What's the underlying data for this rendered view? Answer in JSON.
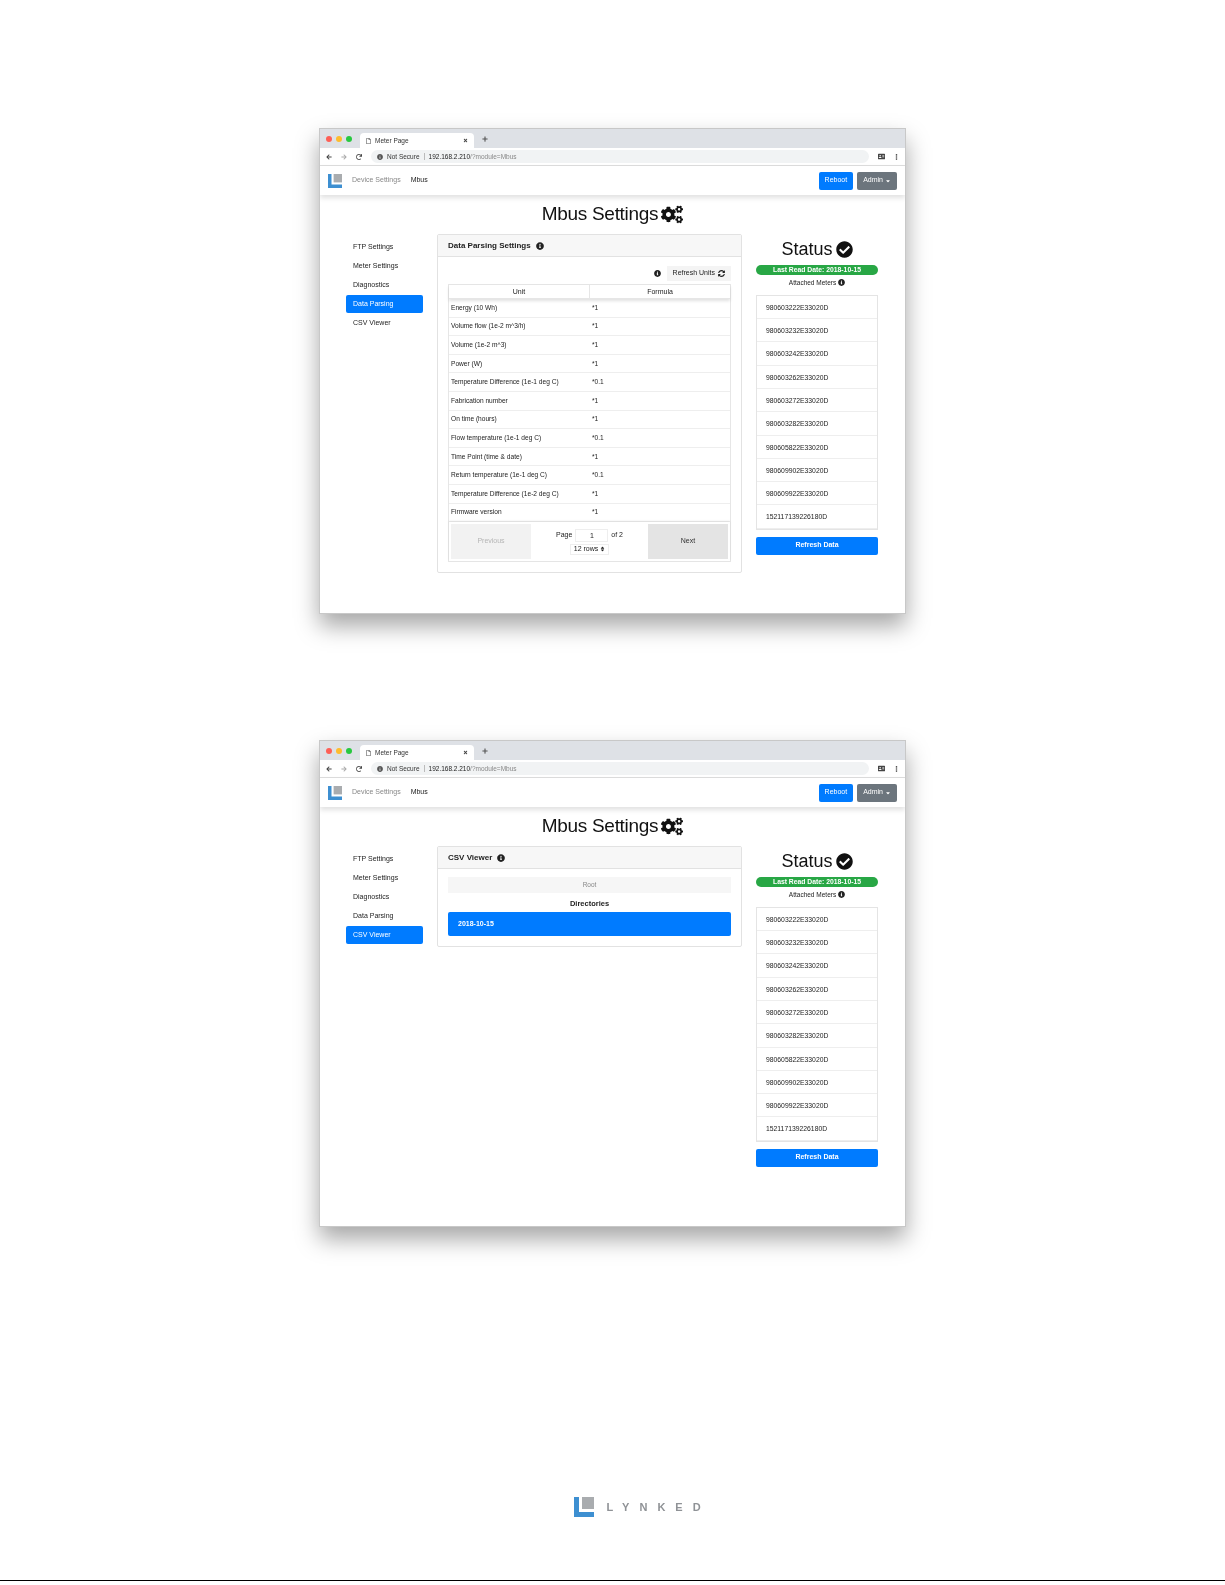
{
  "windows": [
    {
      "tab_title": "Meter Page",
      "security": "Not Secure",
      "url_host": "192.168.2.210",
      "url_path": "/?module=Mbus",
      "breadcrumbs": [
        "Device Settings",
        "Mbus"
      ],
      "reboot": "Reboot",
      "admin": "Admin",
      "page_title": "Mbus Settings",
      "sidebar": [
        {
          "label": "FTP Settings",
          "selected": false
        },
        {
          "label": "Meter Settings",
          "selected": false
        },
        {
          "label": "Diagnostics",
          "selected": false
        },
        {
          "label": "Data Parsing",
          "selected": true
        },
        {
          "label": "CSV Viewer",
          "selected": false
        }
      ],
      "card": {
        "kind": "table",
        "title": "Data Parsing Settings",
        "refresh_button": "Refresh Units",
        "columns": [
          "Unit",
          "Formula"
        ],
        "rows": [
          [
            "Energy (10 Wh)",
            "*1"
          ],
          [
            "Volume flow (1e-2 m^3/h)",
            "*1"
          ],
          [
            "Volume (1e-2 m^3)",
            "*1"
          ],
          [
            "Power (W)",
            "*1"
          ],
          [
            "Temperature Difference (1e-1 deg C)",
            "*0.1"
          ],
          [
            "Fabrication number",
            "*1"
          ],
          [
            "On time (hours)",
            "*1"
          ],
          [
            "Flow temperature (1e-1 deg C)",
            "*0.1"
          ],
          [
            "Time Point (time & date)",
            "*1"
          ],
          [
            "Return temperature (1e-1 deg C)",
            "*0.1"
          ],
          [
            "Temperature Difference (1e-2 deg C)",
            "*1"
          ],
          [
            "Firmware version",
            "*1"
          ]
        ],
        "pagination": {
          "previous": {
            "label": "Previous",
            "disabled": true
          },
          "next": {
            "label": "Next",
            "disabled": false
          },
          "page_label": "Page",
          "page_value": "1",
          "of": "of 2",
          "rows_select": "12 rows"
        }
      },
      "status": {
        "title": "Status",
        "last_read": "Last Read Date: 2018-10-15",
        "attached_label": "Attached Meters",
        "meters": [
          "980603222E33020D",
          "980603232E33020D",
          "980603242E33020D",
          "980603262E33020D",
          "980603272E33020D",
          "980603282E33020D",
          "980605822E33020D",
          "980609902E33020D",
          "980609922E33020D",
          "152117139226180D"
        ],
        "refresh_button": "Refresh Data"
      }
    },
    {
      "tab_title": "Meter Page",
      "security": "Not Secure",
      "url_host": "192.168.2.210",
      "url_path": "/?module=Mbus",
      "breadcrumbs": [
        "Device Settings",
        "Mbus"
      ],
      "reboot": "Reboot",
      "admin": "Admin",
      "page_title": "Mbus Settings",
      "sidebar": [
        {
          "label": "FTP Settings",
          "selected": false
        },
        {
          "label": "Meter Settings",
          "selected": false
        },
        {
          "label": "Diagnostics",
          "selected": false
        },
        {
          "label": "Data Parsing",
          "selected": false
        },
        {
          "label": "CSV Viewer",
          "selected": true
        }
      ],
      "card": {
        "kind": "csv",
        "title": "CSV Viewer",
        "root": "Root",
        "directories_heading": "Directories",
        "directories": [
          {
            "label": "2018-10-15",
            "selected": true
          }
        ]
      },
      "status": {
        "title": "Status",
        "last_read": "Last Read Date: 2018-10-15",
        "attached_label": "Attached Meters",
        "meters": [
          "980603222E33020D",
          "980603232E33020D",
          "980603242E33020D",
          "980603262E33020D",
          "980603272E33020D",
          "980603282E33020D",
          "980605822E33020D",
          "980609902E33020D",
          "980609922E33020D",
          "152117139226180D"
        ],
        "refresh_button": "Refresh Data"
      }
    }
  ],
  "footer": {
    "brand": "LYNKED"
  }
}
